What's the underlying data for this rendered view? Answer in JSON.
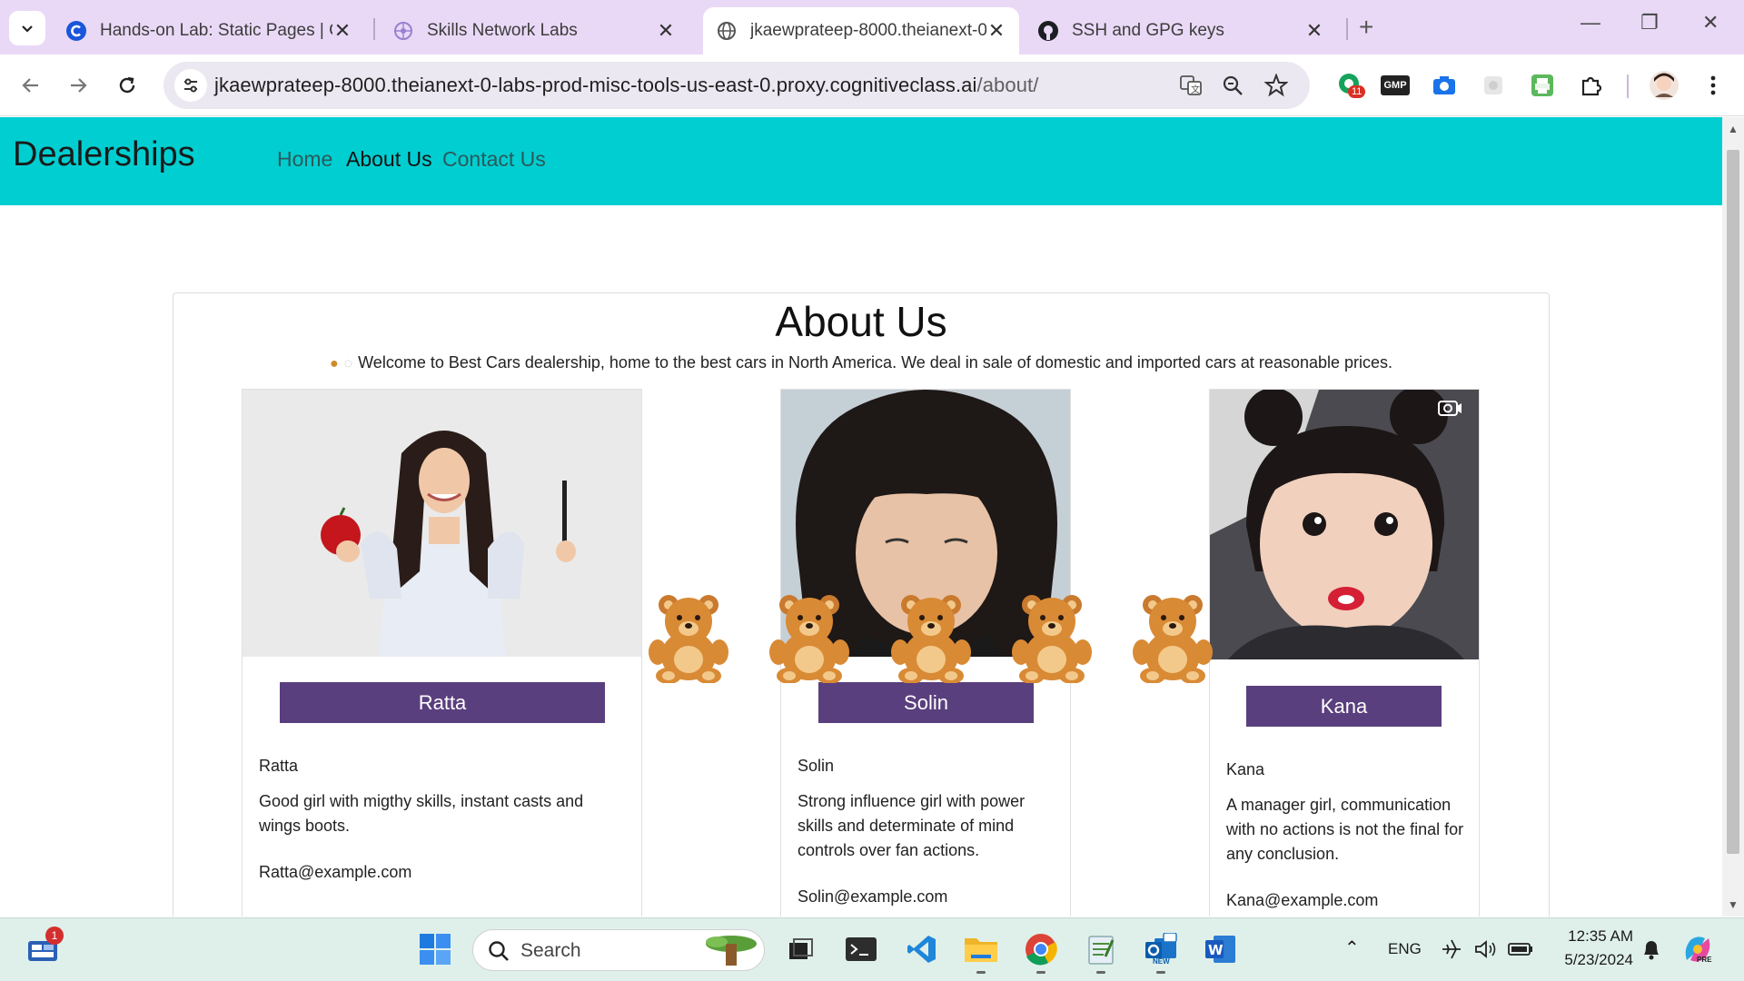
{
  "browser": {
    "tabs": [
      {
        "title": "Hands-on Lab: Static Pages | Co",
        "active": false,
        "favicon": "coursera-c-icon"
      },
      {
        "title": "Skills Network Labs",
        "active": false,
        "favicon": "skills-network-icon"
      },
      {
        "title": "jkaewprateep-8000.theianext-0",
        "active": true,
        "favicon": "globe-icon"
      },
      {
        "title": "SSH and GPG keys",
        "active": false,
        "favicon": "github-icon"
      }
    ],
    "url_host": "jkaewprateep-8000.theianext-0-labs-prod-misc-tools-us-east-0.proxy.cognitiveclass.ai",
    "url_path": "/about/",
    "extension_badge": "11",
    "extension_gmp_label": "GMP"
  },
  "site": {
    "brand": "Dealerships",
    "nav": [
      {
        "label": "Home",
        "active": false
      },
      {
        "label": "About Us",
        "active": true
      },
      {
        "label": "Contact Us",
        "active": false
      }
    ],
    "title": "About Us",
    "welcome": "Welcome to Best Cars dealership, home to the best cars in North America. We deal in sale of domestic and imported cars at reasonable prices.",
    "members": [
      {
        "button": "Ratta",
        "name": "Ratta",
        "description": "Good girl with migthy skills, instant casts and wings boots.",
        "email": "Ratta@example.com"
      },
      {
        "button": "Solin",
        "name": "Solin",
        "description": "Strong influence girl with power skills and determinate of mind controls over fan actions.",
        "email": "Solin@example.com"
      },
      {
        "button": "Kana",
        "name": "Kana",
        "description": "A manager girl, communication with no actions is not the final for any conclusion.",
        "email": "Kana@example.com"
      }
    ]
  },
  "taskbar": {
    "search_label": "Search",
    "language": "ENG",
    "time": "12:35 AM",
    "date": "5/23/2024",
    "notification_badge": "1",
    "new_badge": "NEW",
    "pre_badge": "PRE"
  },
  "colors": {
    "navbar": "#00ced1",
    "name_button": "#5a3f7e",
    "tabbar": "#e9d9f6",
    "taskbar": "#dff0ea"
  }
}
